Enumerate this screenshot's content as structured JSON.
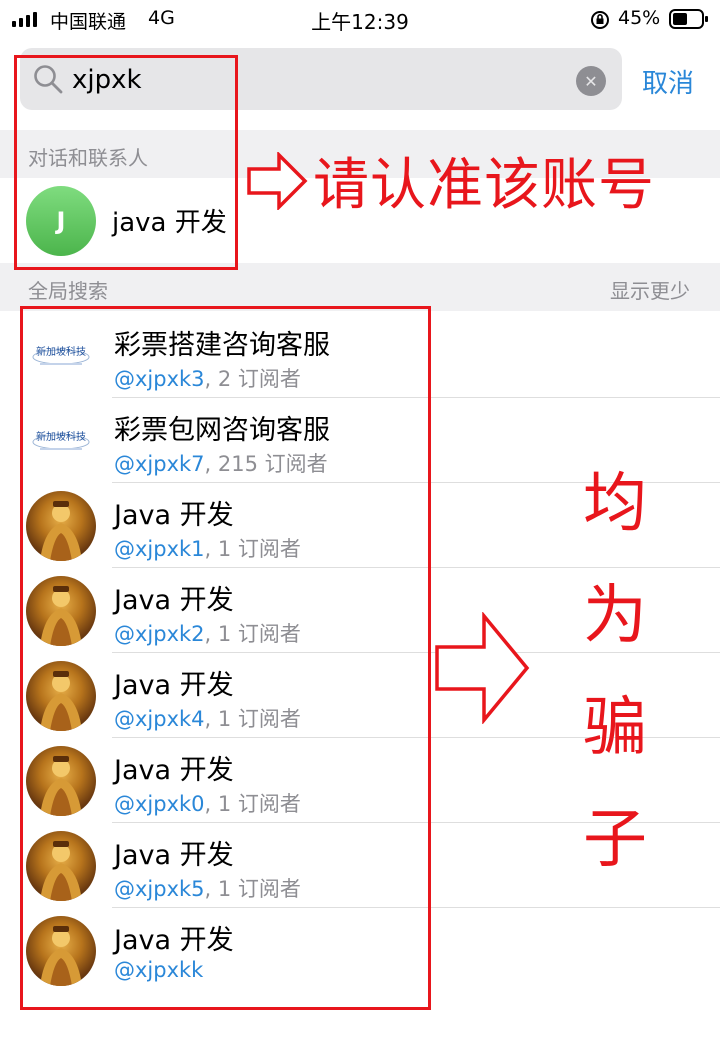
{
  "status_bar": {
    "carrier": "中国联通",
    "network": "4G",
    "time": "上午12:39",
    "battery": "45%"
  },
  "search": {
    "query": "xjpxk",
    "cancel_label": "取消"
  },
  "contacts_section": {
    "title": "对话和联系人",
    "items": [
      {
        "avatar_letter": "J",
        "name": "java 开发"
      }
    ]
  },
  "global_section": {
    "title": "全局搜索",
    "action": "显示更少"
  },
  "results": [
    {
      "title": "彩票搭建咨询客服",
      "handle": "@xjpxk3",
      "meta": ", 2 订阅者",
      "avatar": "logo"
    },
    {
      "title": "彩票包网咨询客服",
      "handle": "@xjpxk7",
      "meta": ", 215 订阅者",
      "avatar": "logo"
    },
    {
      "title": "Java 开发",
      "handle": "@xjpxk1",
      "meta": ", 1 订阅者",
      "avatar": "deity"
    },
    {
      "title": "Java 开发",
      "handle": "@xjpxk2",
      "meta": ", 1 订阅者",
      "avatar": "deity"
    },
    {
      "title": "Java 开发",
      "handle": "@xjpxk4",
      "meta": ", 1 订阅者",
      "avatar": "deity"
    },
    {
      "title": "Java 开发",
      "handle": "@xjpxk0",
      "meta": ", 1 订阅者",
      "avatar": "deity"
    },
    {
      "title": "Java 开发",
      "handle": "@xjpxk5",
      "meta": ", 1 订阅者",
      "avatar": "deity"
    },
    {
      "title": "Java 开发",
      "handle": "@xjpxkk",
      "meta": "",
      "avatar": "deity"
    }
  ],
  "logo_text": "新加坡科技",
  "annotations": {
    "confirm_note": "请认准该账号",
    "scam_chars": [
      "均",
      "为",
      "骗",
      "子"
    ]
  },
  "colors": {
    "accent": "#2a87d8",
    "annotation_red": "#e8161c",
    "avatar_green": "#5cc45c"
  },
  "icons": {
    "search": "search-icon",
    "clear": "clear-icon",
    "battery": "battery-icon",
    "lock": "orientation-lock-icon"
  }
}
